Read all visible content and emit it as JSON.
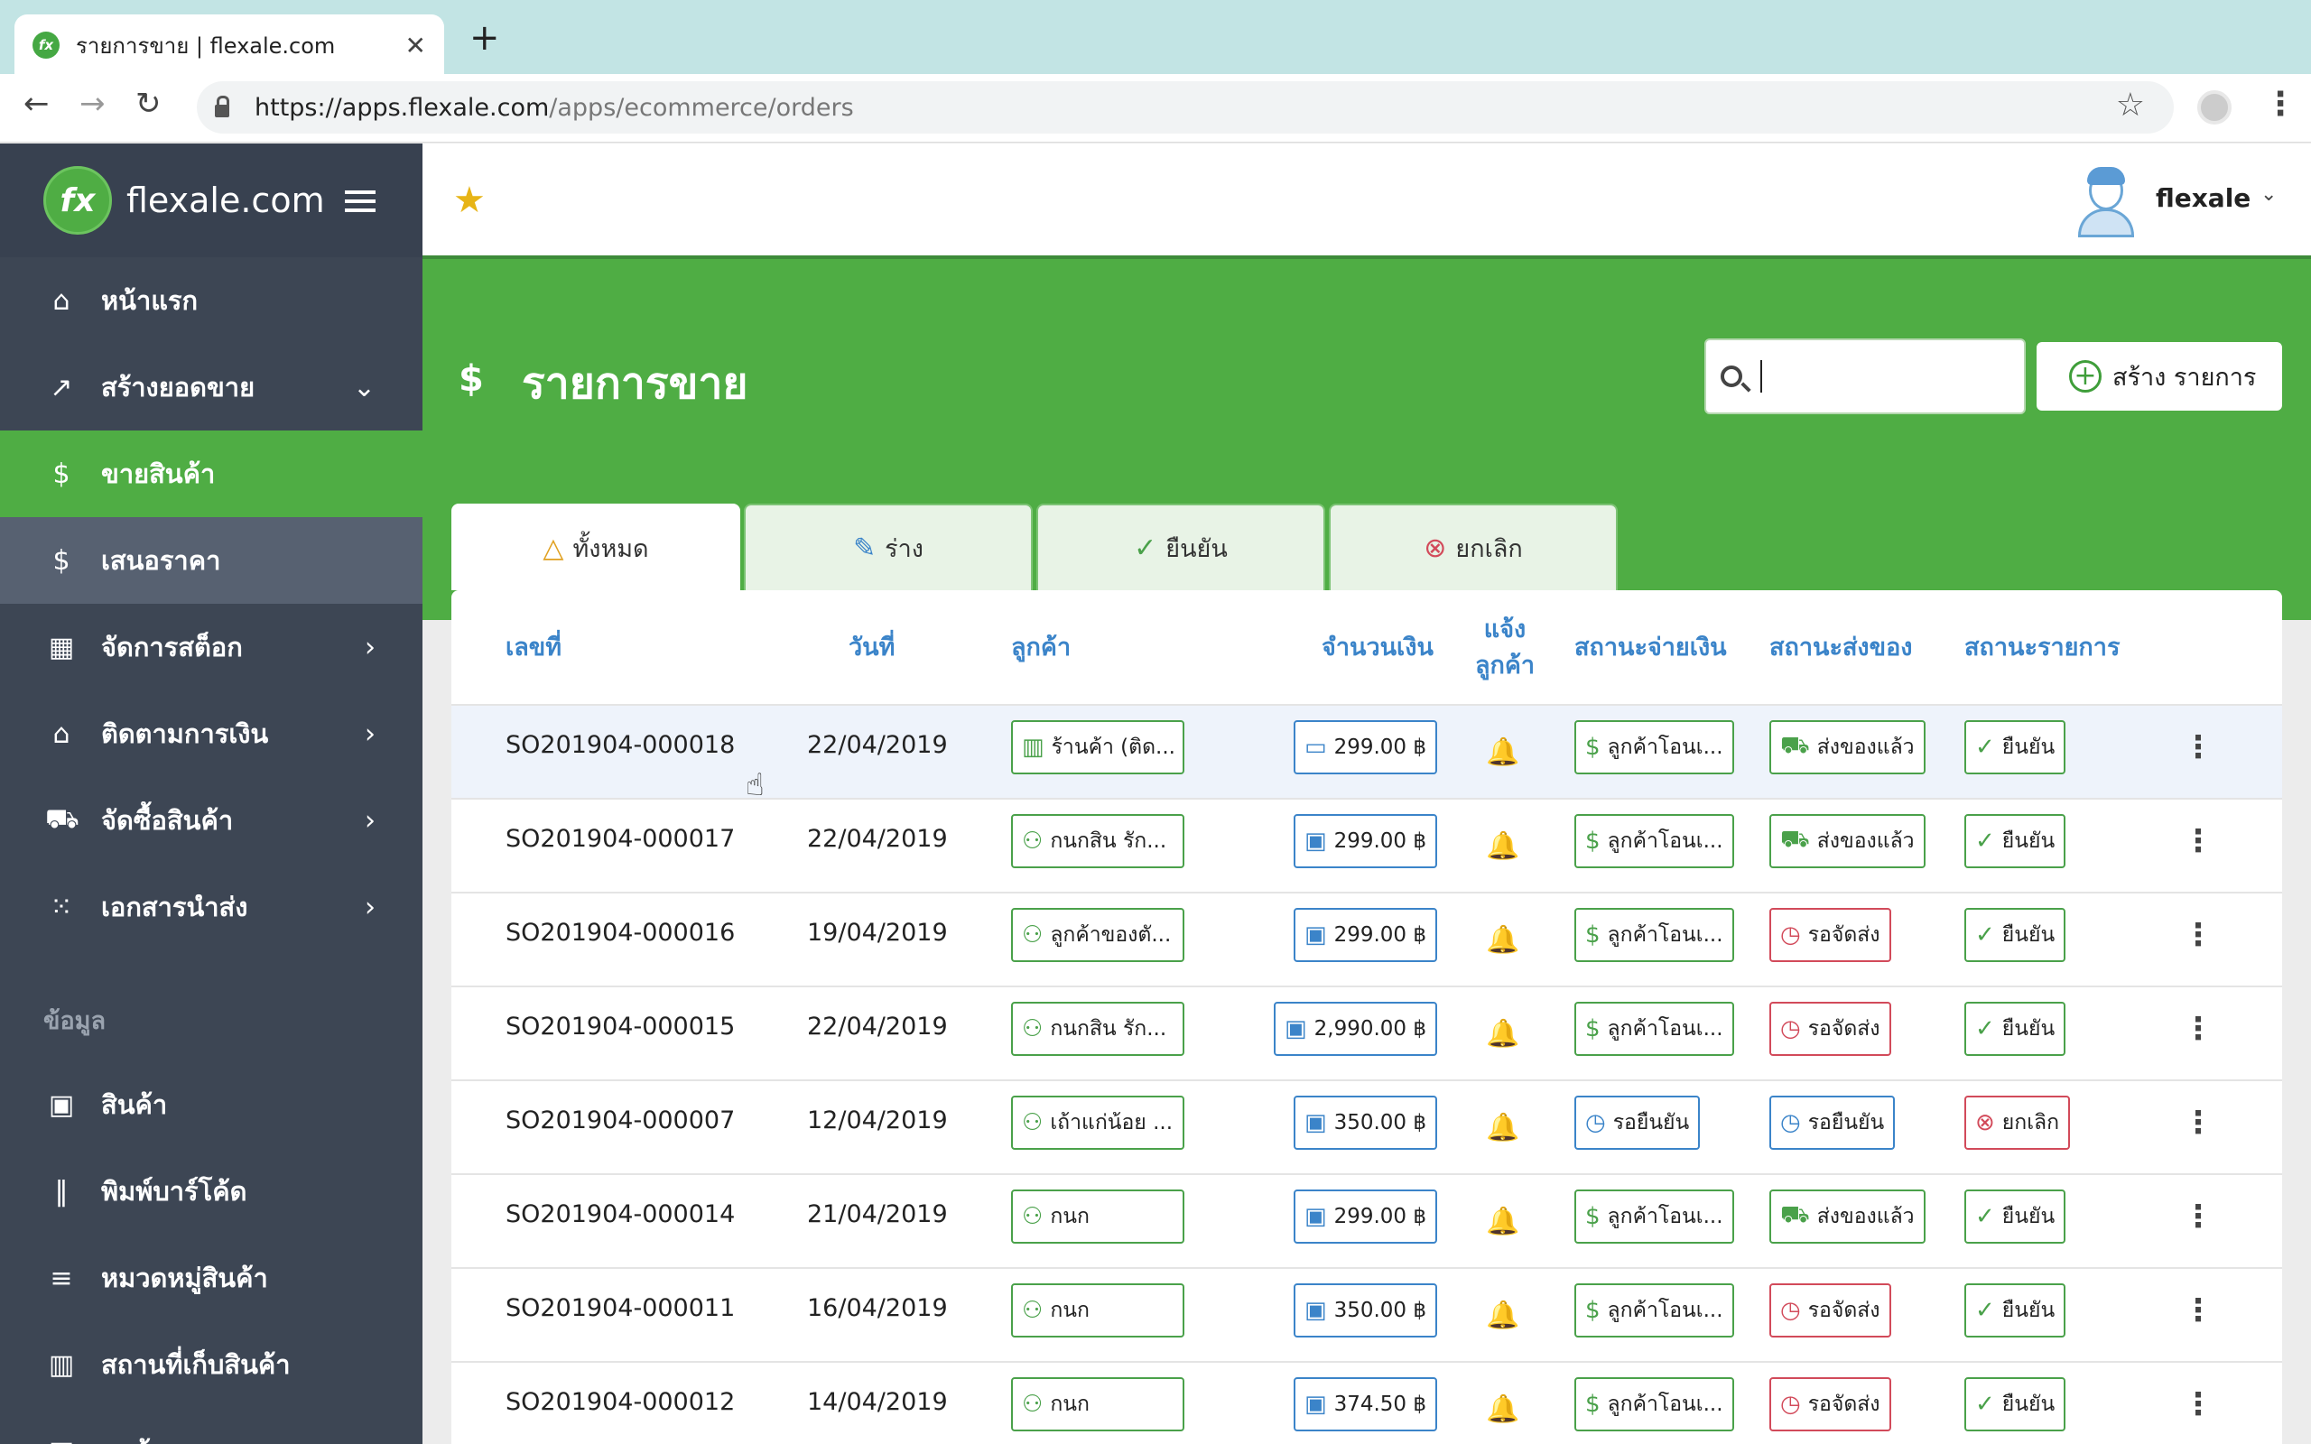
{
  "browser": {
    "tab_title": "รายการขาย | flexale.com",
    "favicon_text": "fx",
    "close_glyph": "✕",
    "new_tab_glyph": "+",
    "url_host": "https://apps.flexale.com",
    "url_path": "/apps/ecommerce/orders",
    "back_glyph": "←",
    "forward_glyph": "→",
    "reload_glyph": "↻",
    "star_glyph": "☆",
    "menu_glyph": "⋮"
  },
  "sidebar": {
    "logo_text": "fx",
    "brand": "flexale.com",
    "items": [
      {
        "label": "หน้าแรก",
        "icon": "home-icon",
        "glyph": "⌂",
        "arrow": "",
        "state": ""
      },
      {
        "label": "สร้างยอดขาย",
        "icon": "trend-icon",
        "glyph": "↗",
        "arrow": "⌄",
        "state": ""
      },
      {
        "label": "ขายสินค้า",
        "icon": "dollar-icon",
        "glyph": "$",
        "arrow": "",
        "state": "active"
      },
      {
        "label": "เสนอราคา",
        "icon": "quote-icon",
        "glyph": "$",
        "arrow": "",
        "state": "sub"
      },
      {
        "label": "จัดการสต็อก",
        "icon": "stock-icon",
        "glyph": "▦",
        "arrow": "›",
        "state": ""
      },
      {
        "label": "ติดตามการเงิน",
        "icon": "bank-icon",
        "glyph": "⌂",
        "arrow": "›",
        "state": ""
      },
      {
        "label": "จัดซื้อสินค้า",
        "icon": "cart-icon",
        "glyph": "⛟",
        "arrow": "›",
        "state": ""
      },
      {
        "label": "เอกสารนำส่ง",
        "icon": "apps-icon",
        "glyph": "⁙",
        "arrow": "›",
        "state": ""
      }
    ],
    "section_label": "ข้อมูล",
    "data_items": [
      {
        "label": "สินค้า",
        "icon": "gift-icon",
        "glyph": "▣"
      },
      {
        "label": "พิมพ์บาร์โค้ด",
        "icon": "barcode-icon",
        "glyph": "‖"
      },
      {
        "label": "หมวดหมู่สินค้า",
        "icon": "list-icon",
        "glyph": "≡"
      },
      {
        "label": "สถานที่เก็บสินค้า",
        "icon": "warehouse-icon",
        "glyph": "▥"
      },
      {
        "label": "ลูกค้า",
        "icon": "customer-icon",
        "glyph": "▣"
      }
    ]
  },
  "topbar": {
    "fav_glyph": "★",
    "user": "flexale",
    "caret": "⌄"
  },
  "header": {
    "icon": "$",
    "title": "รายการขาย",
    "search_placeholder": "",
    "create_label": "สร้าง รายการ",
    "create_glyph": "+"
  },
  "tabs": [
    {
      "label": "ทั้งหมด",
      "glyph": "△",
      "icon": "all-icon",
      "color": "#e0a020",
      "active": true
    },
    {
      "label": "ร่าง",
      "glyph": "✎",
      "icon": "draft-icon",
      "color": "#3b84c9",
      "active": false
    },
    {
      "label": "ยืนยัน",
      "glyph": "✓",
      "icon": "confirm-icon",
      "color": "#4aa14a",
      "active": false
    },
    {
      "label": "ยกเลิก",
      "glyph": "⊗",
      "icon": "cancel-icon",
      "color": "#d24a5a",
      "active": false
    }
  ],
  "table": {
    "headers": {
      "no": "เลขที่",
      "date": "วันที่",
      "customer": "ลูกค้า",
      "amount": "จำนวนเงิน",
      "notify1": "แจ้ง",
      "notify2": "ลูกค้า",
      "pay": "สถานะจ่ายเงิน",
      "ship": "สถานะส่งของ",
      "status": "สถานะรายการ"
    },
    "rows": [
      {
        "no": "SO201904-000018",
        "date": "22/04/2019",
        "customer": "ร้านค้า (ติด...",
        "cust_glyph": "▥",
        "amount": "299.00 ฿",
        "amt_glyph": "▭",
        "pay": "ลูกค้าโอนเ...",
        "pay_glyph": "$",
        "pay_c": "g",
        "ship": "ส่งของแล้ว",
        "ship_glyph": "⛟",
        "ship_c": "g",
        "status": "ยืนยัน",
        "st_glyph": "✓",
        "st_c": "g"
      },
      {
        "no": "SO201904-000017",
        "date": "22/04/2019",
        "customer": "กนกสิน รัก...",
        "cust_glyph": "⚇",
        "amount": "299.00 ฿",
        "amt_glyph": "▣",
        "pay": "ลูกค้าโอนเ...",
        "pay_glyph": "$",
        "pay_c": "g",
        "ship": "ส่งของแล้ว",
        "ship_glyph": "⛟",
        "ship_c": "g",
        "status": "ยืนยัน",
        "st_glyph": "✓",
        "st_c": "g"
      },
      {
        "no": "SO201904-000016",
        "date": "19/04/2019",
        "customer": "ลูกค้าของตั...",
        "cust_glyph": "⚇",
        "amount": "299.00 ฿",
        "amt_glyph": "▣",
        "pay": "ลูกค้าโอนเ...",
        "pay_glyph": "$",
        "pay_c": "g",
        "ship": "รอจัดส่ง",
        "ship_glyph": "◷",
        "ship_c": "r",
        "status": "ยืนยัน",
        "st_glyph": "✓",
        "st_c": "g"
      },
      {
        "no": "SO201904-000015",
        "date": "22/04/2019",
        "customer": "กนกสิน รัก...",
        "cust_glyph": "⚇",
        "amount": "2,990.00 ฿",
        "amt_glyph": "▣",
        "pay": "ลูกค้าโอนเ...",
        "pay_glyph": "$",
        "pay_c": "g",
        "ship": "รอจัดส่ง",
        "ship_glyph": "◷",
        "ship_c": "r",
        "status": "ยืนยัน",
        "st_glyph": "✓",
        "st_c": "g"
      },
      {
        "no": "SO201904-000007",
        "date": "12/04/2019",
        "customer": "เถ้าแก่น้อย ...",
        "cust_glyph": "⚇",
        "amount": "350.00 ฿",
        "amt_glyph": "▣",
        "pay": "รอยืนยัน",
        "pay_glyph": "◷",
        "pay_c": "b",
        "ship": "รอยืนยัน",
        "ship_glyph": "◷",
        "ship_c": "b",
        "status": "ยกเลิก",
        "st_glyph": "⊗",
        "st_c": "r"
      },
      {
        "no": "SO201904-000014",
        "date": "21/04/2019",
        "customer": "กนก",
        "cust_glyph": "⚇",
        "amount": "299.00 ฿",
        "amt_glyph": "▣",
        "pay": "ลูกค้าโอนเ...",
        "pay_glyph": "$",
        "pay_c": "g",
        "ship": "ส่งของแล้ว",
        "ship_glyph": "⛟",
        "ship_c": "g",
        "status": "ยืนยัน",
        "st_glyph": "✓",
        "st_c": "g"
      },
      {
        "no": "SO201904-000011",
        "date": "16/04/2019",
        "customer": "กนก",
        "cust_glyph": "⚇",
        "amount": "350.00 ฿",
        "amt_glyph": "▣",
        "pay": "ลูกค้าโอนเ...",
        "pay_glyph": "$",
        "pay_c": "g",
        "ship": "รอจัดส่ง",
        "ship_glyph": "◷",
        "ship_c": "r",
        "status": "ยืนยัน",
        "st_glyph": "✓",
        "st_c": "g"
      },
      {
        "no": "SO201904-000012",
        "date": "14/04/2019",
        "customer": "กนก",
        "cust_glyph": "⚇",
        "amount": "374.50 ฿",
        "amt_glyph": "▣",
        "pay": "ลูกค้าโอนเ...",
        "pay_glyph": "$",
        "pay_c": "g",
        "ship": "รอจัดส่ง",
        "ship_glyph": "◷",
        "ship_c": "r",
        "status": "ยืนยัน",
        "st_glyph": "✓",
        "st_c": "g"
      }
    ],
    "bell_glyph": "🔔",
    "row_menu_glyph": "⋮"
  },
  "colors": {
    "brand_green": "#4fad44",
    "sidebar": "#3d4654",
    "link_blue": "#3b84c9",
    "danger": "#d24a5a"
  }
}
